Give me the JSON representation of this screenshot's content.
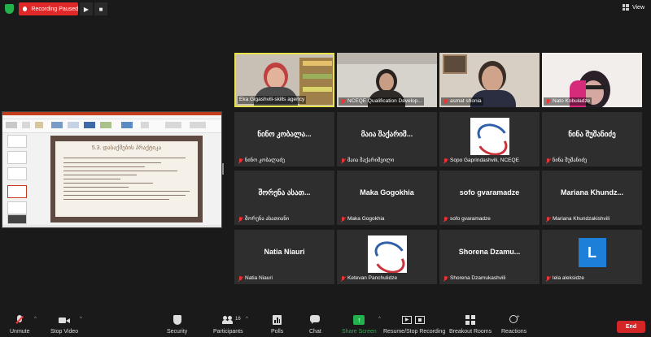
{
  "topbar": {
    "recording_label": "Recording Paused",
    "pause_icon": "play-icon",
    "stop_icon": "stop-icon",
    "view_label": "View"
  },
  "shared_slide": {
    "title": "5.3. დასაქმების პრაქტიკა"
  },
  "participants": [
    {
      "display": "",
      "label": "Eka Gigashvili-skills agency",
      "muted": false,
      "type": "video"
    },
    {
      "display": "",
      "label": "NCEQE Qualification Develop...",
      "muted": true,
      "type": "video"
    },
    {
      "display": "",
      "label": "asmat shonia",
      "muted": true,
      "type": "video"
    },
    {
      "display": "",
      "label": "Nato Kobuladze",
      "muted": true,
      "type": "video"
    },
    {
      "display": "ნინო კობალა...",
      "label": "ნინო კობალაძე",
      "muted": true,
      "type": "name"
    },
    {
      "display": "მაია შაქარიშ...",
      "label": "მაია შაქარიშვილი",
      "muted": true,
      "type": "name"
    },
    {
      "display": "",
      "label": "Sopo Gaprindashvili, NCEQE",
      "muted": true,
      "type": "logo"
    },
    {
      "display": "ნინა შუშანიძე",
      "label": "ნინა შუშანიძე",
      "muted": true,
      "type": "name"
    },
    {
      "display": "შორენა ასათ...",
      "label": "შორენა ასათიანი",
      "muted": true,
      "type": "name"
    },
    {
      "display": "Maka Gogokhia",
      "label": "Maka Gogokhia",
      "muted": true,
      "type": "name"
    },
    {
      "display": "sofo gvaramadze",
      "label": "sofo gvaramadze",
      "muted": true,
      "type": "name"
    },
    {
      "display": "Mariana  Khundz...",
      "label": "Mariana Khundzakishvili",
      "muted": true,
      "type": "name"
    },
    {
      "display": "Natia Niauri",
      "label": "Natia Niauri",
      "muted": true,
      "type": "name"
    },
    {
      "display": "",
      "label": "Ketevan Panchulidze",
      "muted": true,
      "type": "logo"
    },
    {
      "display": "Shorena  Dzamu...",
      "label": "Shorena Dzamukashvili",
      "muted": true,
      "type": "name"
    },
    {
      "display": "L",
      "label": "lela aleksidze",
      "muted": true,
      "type": "avatar"
    }
  ],
  "toolbar": {
    "unmute": "Unmute",
    "stop_video": "Stop Video",
    "security": "Security",
    "participants": "Participants",
    "participants_count": "16",
    "polls": "Polls",
    "chat": "Chat",
    "share_screen": "Share Screen",
    "record": "Resume/Stop Recording",
    "breakout": "Breakout Rooms",
    "reactions": "Reactions",
    "end": "End"
  },
  "colors": {
    "accent_green": "#22b14c",
    "record_red": "#e02828",
    "active_speaker": "#e8e34a",
    "avatar_blue": "#1e7fd8"
  }
}
